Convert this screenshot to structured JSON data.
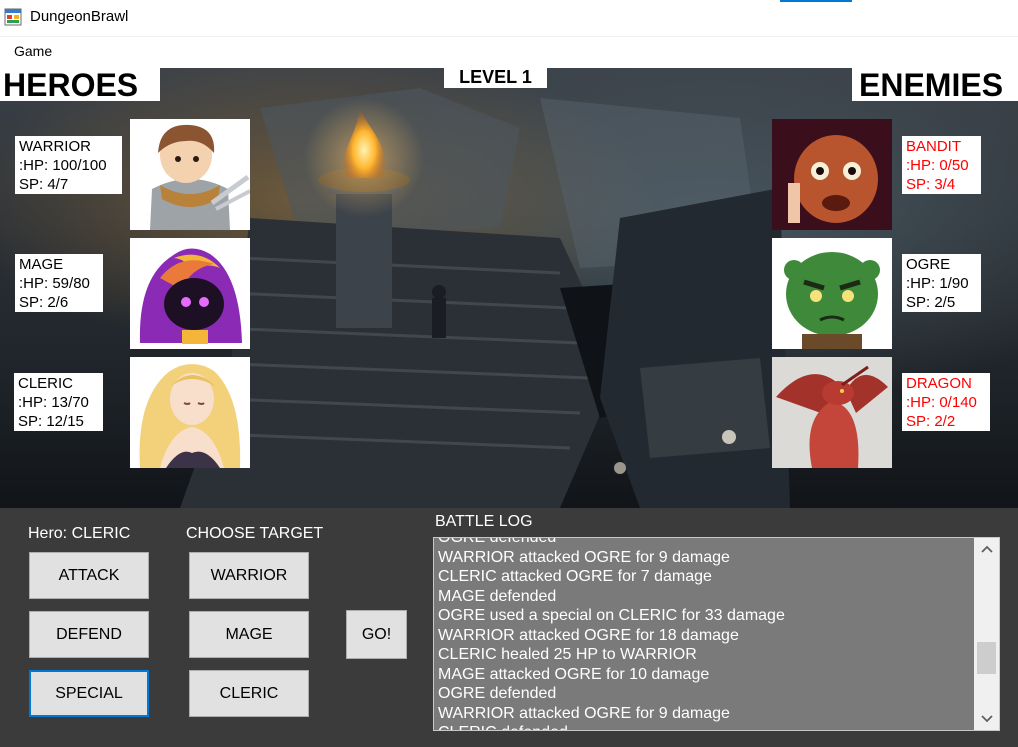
{
  "window": {
    "title": "DungeonBrawl",
    "icon": "app-window-icon"
  },
  "menu": {
    "game": "Game"
  },
  "banners": {
    "heroes": "HEROES",
    "enemies": "ENEMIES",
    "level": "LEVEL 1"
  },
  "heroes": [
    {
      "name": "WARRIOR",
      "hp": ":HP: 100/100",
      "sp": "SP: 4/7",
      "icon": "warrior-portrait"
    },
    {
      "name": "MAGE",
      "hp": ":HP: 59/80",
      "sp": "SP: 2/6",
      "icon": "mage-portrait"
    },
    {
      "name": "CLERIC",
      "hp": ":HP: 13/70",
      "sp": "SP: 12/15",
      "icon": "cleric-portrait"
    }
  ],
  "enemies": [
    {
      "name": "BANDIT",
      "hp": ":HP: 0/50",
      "sp": "SP: 3/4",
      "defeated": true,
      "icon": "bandit-portrait"
    },
    {
      "name": "OGRE",
      "hp": ":HP: 1/90",
      "sp": "SP: 2/5",
      "defeated": false,
      "icon": "ogre-portrait"
    },
    {
      "name": "DRAGON",
      "hp": ":HP: 0/140",
      "sp": "SP: 2/2",
      "defeated": true,
      "icon": "dragon-portrait"
    }
  ],
  "controls": {
    "hero_label": "Hero: CLERIC",
    "target_label": "CHOOSE TARGET",
    "actions": [
      "ATTACK",
      "DEFEND",
      "SPECIAL"
    ],
    "targets": [
      "WARRIOR",
      "MAGE",
      "CLERIC"
    ],
    "go": "GO!"
  },
  "battle_log": {
    "title": "BATTLE LOG",
    "lines": [
      "OGRE defended",
      "WARRIOR attacked OGRE for 9 damage",
      "CLERIC attacked OGRE for 7 damage",
      "MAGE defended",
      "OGRE used a special on CLERIC for 33 damage",
      "WARRIOR attacked OGRE for 18 damage",
      "CLERIC healed 25 HP to WARRIOR",
      "MAGE attacked OGRE for 10 damage",
      "OGRE defended",
      "WARRIOR attacked OGRE for 9 damage",
      "CLERIC defended"
    ]
  },
  "colors": {
    "defeated_text": "#ff0000",
    "panel_bg": "#3b3b3b",
    "log_bg": "#7a7a7a",
    "focus": "#0078d7"
  }
}
